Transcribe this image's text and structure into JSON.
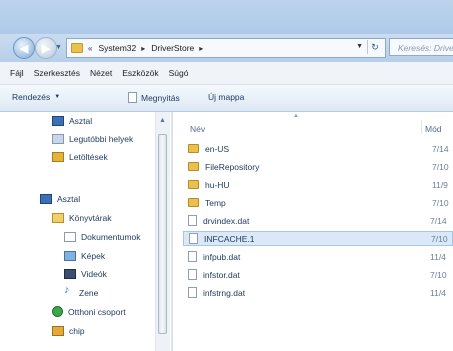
{
  "address_bar": {
    "crumbs": [
      "System32",
      "DriverStore"
    ],
    "search_placeholder": "Keresés: DriverStore"
  },
  "menu": [
    "Fájl",
    "Szerkesztés",
    "Nézet",
    "Eszközök",
    "Súgó"
  ],
  "toolbar": {
    "organize": "Rendezés",
    "open": "Megnyitás",
    "new_folder": "Új mappa"
  },
  "nav": {
    "items": [
      {
        "label": "Asztal",
        "icon": "desktop-icon"
      },
      {
        "label": "Legutóbbi helyek",
        "icon": "recent-places-icon"
      },
      {
        "label": "Letöltések",
        "icon": "downloads-icon"
      },
      {
        "label": "Asztal",
        "icon": "desktop-icon"
      },
      {
        "label": "Könyvtárak",
        "icon": "libraries-icon"
      },
      {
        "label": "Dokumentumok",
        "icon": "documents-icon"
      },
      {
        "label": "Képek",
        "icon": "pictures-icon"
      },
      {
        "label": "Videók",
        "icon": "videos-icon"
      },
      {
        "label": "Zene",
        "icon": "music-icon"
      },
      {
        "label": "Otthoni csoport",
        "icon": "homegroup-icon"
      },
      {
        "label": "chip",
        "icon": "chip-icon"
      }
    ]
  },
  "columns": {
    "name": "Név",
    "date": "Mód"
  },
  "files": [
    {
      "name": "en-US",
      "date": "7/14",
      "type": "folder"
    },
    {
      "name": "FileRepository",
      "date": "7/10",
      "type": "folder"
    },
    {
      "name": "hu-HU",
      "date": "11/9",
      "type": "folder"
    },
    {
      "name": "Temp",
      "date": "7/10",
      "type": "folder"
    },
    {
      "name": "drvindex.dat",
      "date": "7/14",
      "type": "file"
    },
    {
      "name": "INFCACHE.1",
      "date": "7/10",
      "type": "file",
      "selected": true
    },
    {
      "name": "infpub.dat",
      "date": "11/4",
      "type": "file"
    },
    {
      "name": "infstor.dat",
      "date": "7/10",
      "type": "file"
    },
    {
      "name": "infstrng.dat",
      "date": "11/4",
      "type": "file"
    }
  ],
  "colors": {
    "chrome": "#bcd3ec",
    "selection": "#dbe8f7",
    "folder": "#eac14f",
    "text": "#1e395b"
  }
}
